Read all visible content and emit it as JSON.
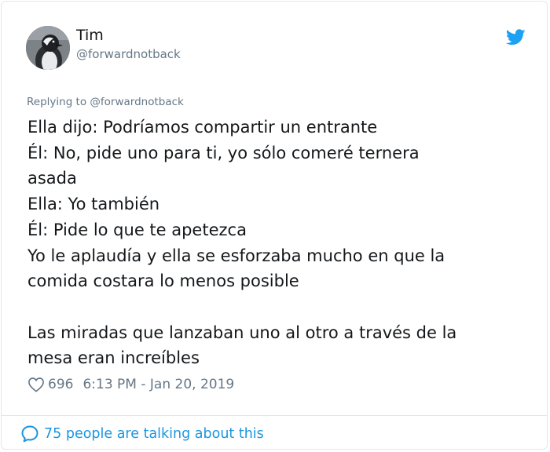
{
  "author": {
    "name": "Tim",
    "handle": "@forwardnotback"
  },
  "reply_context": "Replying to @forwardnotback",
  "tweet": {
    "lines": [
      "Ella dijo: Podríamos compartir un entrante",
      "Él: No, pide uno para ti, yo sólo comeré ternera",
      "asada",
      "Ella: Yo también",
      "Él: Pide lo que te apetezca",
      "Yo le aplaudía y ella se esforzaba mucho en que la",
      "comida costara lo menos posible",
      "",
      "Las miradas que lanzaban uno al otro a través de la",
      "mesa eran increíbles"
    ]
  },
  "stats": {
    "likes": "696",
    "timestamp": "6:13 PM - Jan 20, 2019"
  },
  "footer": {
    "conversation_label": "75 people are talking about this"
  },
  "icons": {
    "brand": "twitter-bird-icon",
    "like": "heart-icon",
    "conversation": "speech-bubble-icon"
  },
  "colors": {
    "accent": "#1da1f2",
    "link": "#1b95e0",
    "secondary_text": "#657786",
    "primary_text": "#14171a",
    "border": "#e1e8ed"
  }
}
